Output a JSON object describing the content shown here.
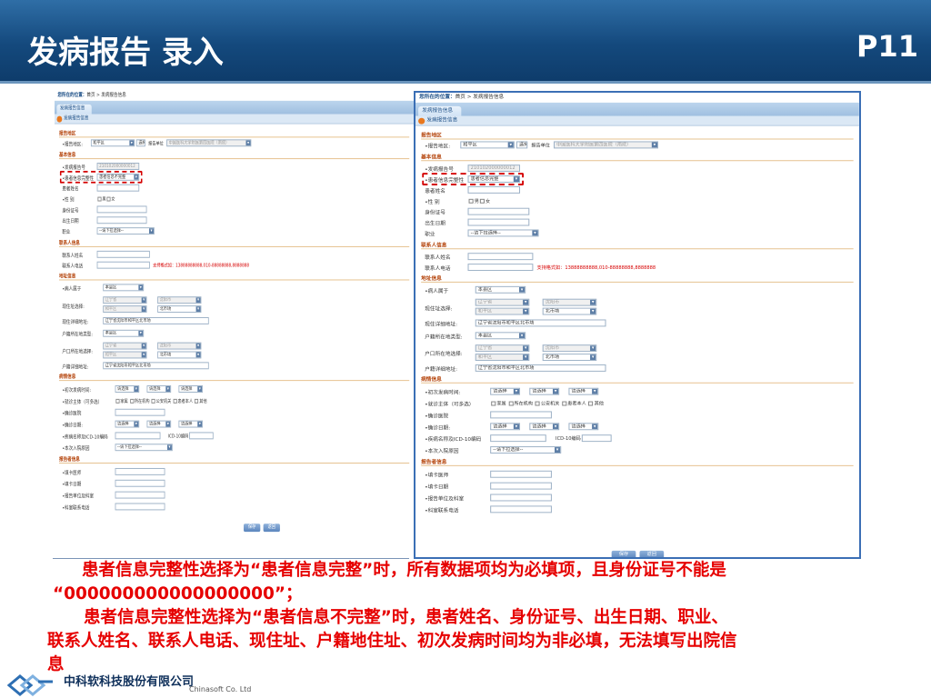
{
  "header": {
    "title": "发病报告 录入",
    "page": "P11"
  },
  "screen": {
    "breadcrumb_label": "您所在的位置：",
    "breadcrumb": "首页 > 发病报告信息",
    "tab": "发病报告信息",
    "panel_title": "发病报告信息",
    "sections": {
      "area": "报告地区",
      "basic": "基本信息",
      "contact": "联系人信息",
      "address": "地址信息",
      "case": "病情信息",
      "reporter": "报告者信息"
    },
    "labels": {
      "report_area": "•报告地区:",
      "report_unit": "报告单位",
      "report_no": "•发病报告号",
      "integrity": "•患者信息完整性",
      "name": "患者姓名",
      "sex": "•性 别",
      "idno": "身份证号",
      "birth": "出生日期",
      "job": "职业",
      "contact_name": "联系人姓名",
      "contact_phone": "联系人电话",
      "phone_hint": "支持格式如：13888888888,010-88888888,8888888",
      "belongs": "•病人属于",
      "cur_addr": "现住址选择:",
      "cur_addr_detail": "现住详细地址:",
      "hukou_type": "户籍所在地类型:",
      "hukou_addr": "户口所在地选择:",
      "hukou_detail": "户籍详细地址:",
      "onset": "•初次发病时间:",
      "clinic": "•就诊主体（可多选）",
      "hospital": "•确诊医院",
      "diag_date": "•确诊日期:",
      "icd": "•疾病名称及ICD-10编码",
      "icd_code": "ICD-10编码",
      "visit": "•本次入院原因",
      "card_doctor": "•填卡医师",
      "card_date": "•填卡日期",
      "report_dept": "•报告单位及科室",
      "dept_phone": "•科室联系电话"
    },
    "values": {
      "district": "和平区",
      "btn_select": "选择",
      "unit": "中国医科大学附属第四医院（南院）",
      "report_no": "210102000000012",
      "integrity_left": "患者信息不完整",
      "integrity_right": "患者信息完整",
      "male": "男",
      "female": "女",
      "job_select": "--请下拉选择--",
      "local": "本县区",
      "province": "辽宁省",
      "city": "沈阳市",
      "district2": "和平区",
      "street": "北市场",
      "sheng": "省",
      "shi": "市",
      "qu": "县",
      "xiang": "乡",
      "addr_detail": "辽宁省沈阳市和平区北市场",
      "please": "请选择",
      "year": "年",
      "month": "月",
      "day": "日",
      "c1": "家属",
      "c2": "所在机构",
      "c3": "公安机关",
      "c4": "患者本人",
      "c5": "其他"
    },
    "buttons": {
      "save": "保存",
      "back": "返回"
    }
  },
  "caption": {
    "line1": "患者信息完整性选择为“患者信息完整”时，所有数据项均为必填项，且身份证号不能是",
    "line2": "“000000000000000000”；",
    "line3": "患者信息完整性选择为“患者信息不完整”时，患者姓名、身份证号、出生日期、职业、",
    "line4": "联系人姓名、联系人电话、现住址、户籍地住址、初次发病时间均为非必填，无法填写出院信",
    "line5": "息"
  },
  "footer": {
    "company": "中科软科技股份有限公司",
    "company_en": "Chinasoft Co. Ltd"
  },
  "colors": {
    "header": "#14497d",
    "accent_red": "#e60000",
    "section": "#b4430a"
  }
}
